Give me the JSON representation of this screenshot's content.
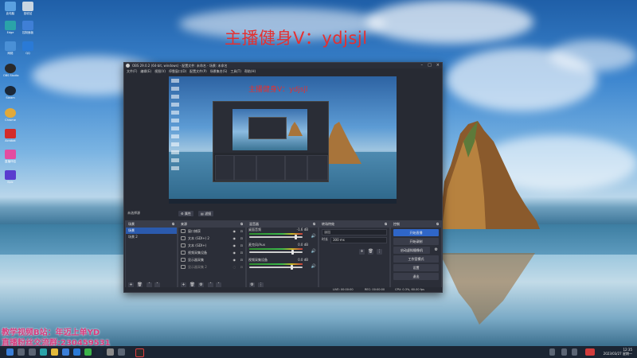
{
  "desktop": {
    "watermark": "主播健身V：ydjsjl",
    "promo_line1": "教学视频B站：年迈上单YD",
    "promo_line2": "直播粉丝交流群:230459531",
    "icons": [
      {
        "label": "此电脑",
        "icon": "computer-icon",
        "color": "#5aa0e0"
      },
      {
        "label": "回收站",
        "icon": "recycle-bin-icon",
        "color": "#c9d6e2"
      },
      {
        "label": "Edge",
        "icon": "edge-icon",
        "color": "#2aa3a9"
      },
      {
        "label": "控制面板",
        "icon": "control-panel-icon",
        "color": "#3f7fd6"
      },
      {
        "label": "网络",
        "icon": "network-icon",
        "color": "#4a90d6"
      },
      {
        "label": "QQ",
        "icon": "qq-icon",
        "color": "#2a7ad6"
      },
      {
        "label": "OBS Studio",
        "icon": "obs-icon",
        "color": "#2a2a2a"
      },
      {
        "label": "Steam",
        "icon": "steam-icon",
        "color": "#1b2838"
      },
      {
        "label": "Chrome",
        "icon": "chrome-icon",
        "color": "#e2a93a"
      },
      {
        "label": "Acrobat",
        "icon": "acrobat-icon",
        "color": "#d22b2b"
      },
      {
        "label": "直播伴侣",
        "icon": "live-companion-icon",
        "color": "#e34ca0"
      },
      {
        "label": "Epic",
        "icon": "epic-icon",
        "color": "#5a3ccf"
      }
    ]
  },
  "obs": {
    "title": "OBS 29.0.2 (64-bit, windows) - 配置文件: 未命名 - 场景: 未命名",
    "menu": [
      "文件(F)",
      "编辑(E)",
      "视图(V)",
      "停靠窗口(D)",
      "配置文件(P)",
      "场景集合(S)",
      "工具(T)",
      "帮助(H)"
    ],
    "preview_text": "主播健身V：ydjsjl",
    "controls_label": "未选择源",
    "properties_button": "属性",
    "filters_button": "滤镜",
    "docks": {
      "scenes": {
        "title": "场景",
        "items": [
          "场景",
          "场景 2"
        ],
        "selected": 0
      },
      "sources": {
        "title": "来源",
        "items": [
          {
            "name": "窗口捕获",
            "visible": true
          },
          {
            "name": "文本 (GDI+) 2",
            "visible": true
          },
          {
            "name": "文本 (GDI+)",
            "visible": true
          },
          {
            "name": "视频采集设备",
            "visible": true
          },
          {
            "name": "显示器采集",
            "visible": true
          },
          {
            "name": "显示器采集 2",
            "visible": false
          }
        ]
      },
      "mixer": {
        "title": "混音器",
        "channels": [
          {
            "name": "桌面音频",
            "db": "-1.6 dB",
            "level": 0.88
          },
          {
            "name": "麦克风/Aux",
            "db": "0.0 dB",
            "level": 0.82
          },
          {
            "name": "视频采集设备",
            "db": "0.0 dB",
            "level": 0.8
          }
        ]
      },
      "transitions": {
        "title": "转场特效",
        "type": "淡出",
        "duration_label": "时长",
        "duration": "300 ms"
      },
      "controls": {
        "title": "控制",
        "buttons": [
          "开始直播",
          "开始录制",
          "启动虚拟摄像机",
          "工作室模式",
          "设置",
          "退出"
        ]
      }
    },
    "status": {
      "live": "LIVE: 00:00:00",
      "rec": "REC: 00:00:00",
      "cpu": "CPU: 0.3%, 60.00 fps"
    }
  },
  "taskbar": {
    "time": "12:35",
    "date": "2023/03/27 星期一"
  },
  "colors": {
    "accent": "#2f66c8",
    "watermark": "#e53030",
    "promo": "#d63b7d"
  }
}
